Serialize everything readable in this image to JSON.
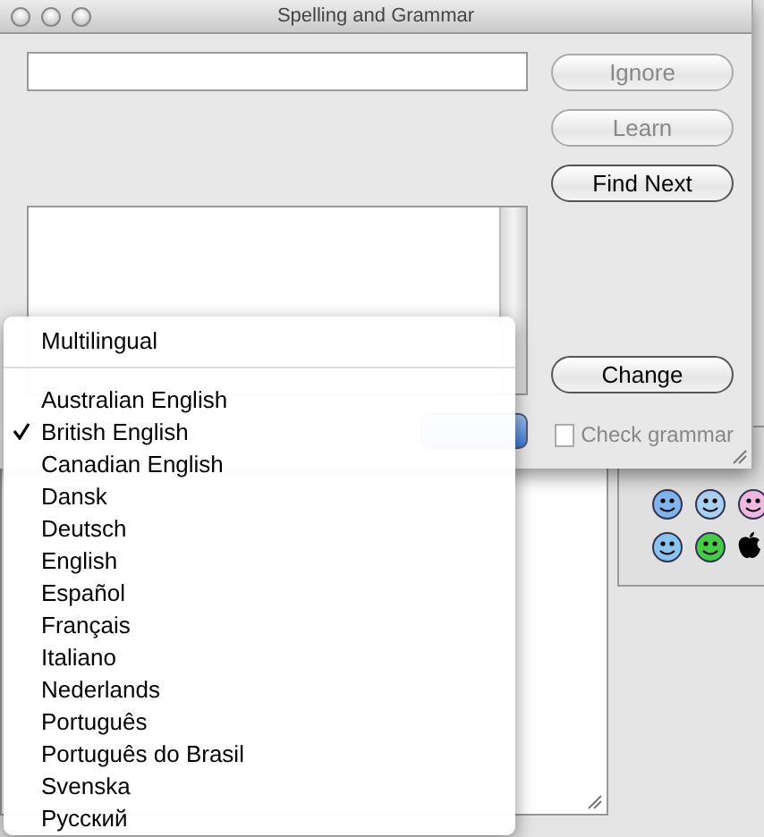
{
  "window": {
    "title": "Spelling and Grammar"
  },
  "buttons": [
    {
      "label": "Ignore",
      "disabled": true
    },
    {
      "label": "Learn",
      "disabled": true
    },
    {
      "label": "Find Next",
      "disabled": false
    }
  ],
  "change_button": {
    "label": "Change",
    "disabled": false
  },
  "check_grammar": {
    "label": "Check grammar",
    "checked": false,
    "disabled": true
  },
  "language_menu": {
    "groups": [
      [
        {
          "label": "Multilingual",
          "selected": false
        }
      ],
      [
        {
          "label": "Australian English",
          "selected": false
        },
        {
          "label": "British English",
          "selected": true
        },
        {
          "label": "Canadian English",
          "selected": false
        },
        {
          "label": "Dansk",
          "selected": false
        },
        {
          "label": "Deutsch",
          "selected": false
        },
        {
          "label": "English",
          "selected": false
        },
        {
          "label": "Español",
          "selected": false
        },
        {
          "label": "Français",
          "selected": false
        },
        {
          "label": "Italiano",
          "selected": false
        },
        {
          "label": "Nederlands",
          "selected": false
        },
        {
          "label": "Português",
          "selected": false
        },
        {
          "label": "Português do Brasil",
          "selected": false
        },
        {
          "label": "Svenska",
          "selected": false
        },
        {
          "label": "Русский",
          "selected": false
        }
      ]
    ]
  },
  "emoticons": [
    {
      "kind": "smiley",
      "color": "#7fb4ec"
    },
    {
      "kind": "smiley",
      "color": "#a8d0f0"
    },
    {
      "kind": "smiley",
      "color": "#f0b8e0"
    },
    {
      "kind": "smiley",
      "color": "#88c4f0"
    },
    {
      "kind": "smiley",
      "color": "#44cc44"
    },
    {
      "kind": "apple",
      "color": "#000000"
    }
  ]
}
